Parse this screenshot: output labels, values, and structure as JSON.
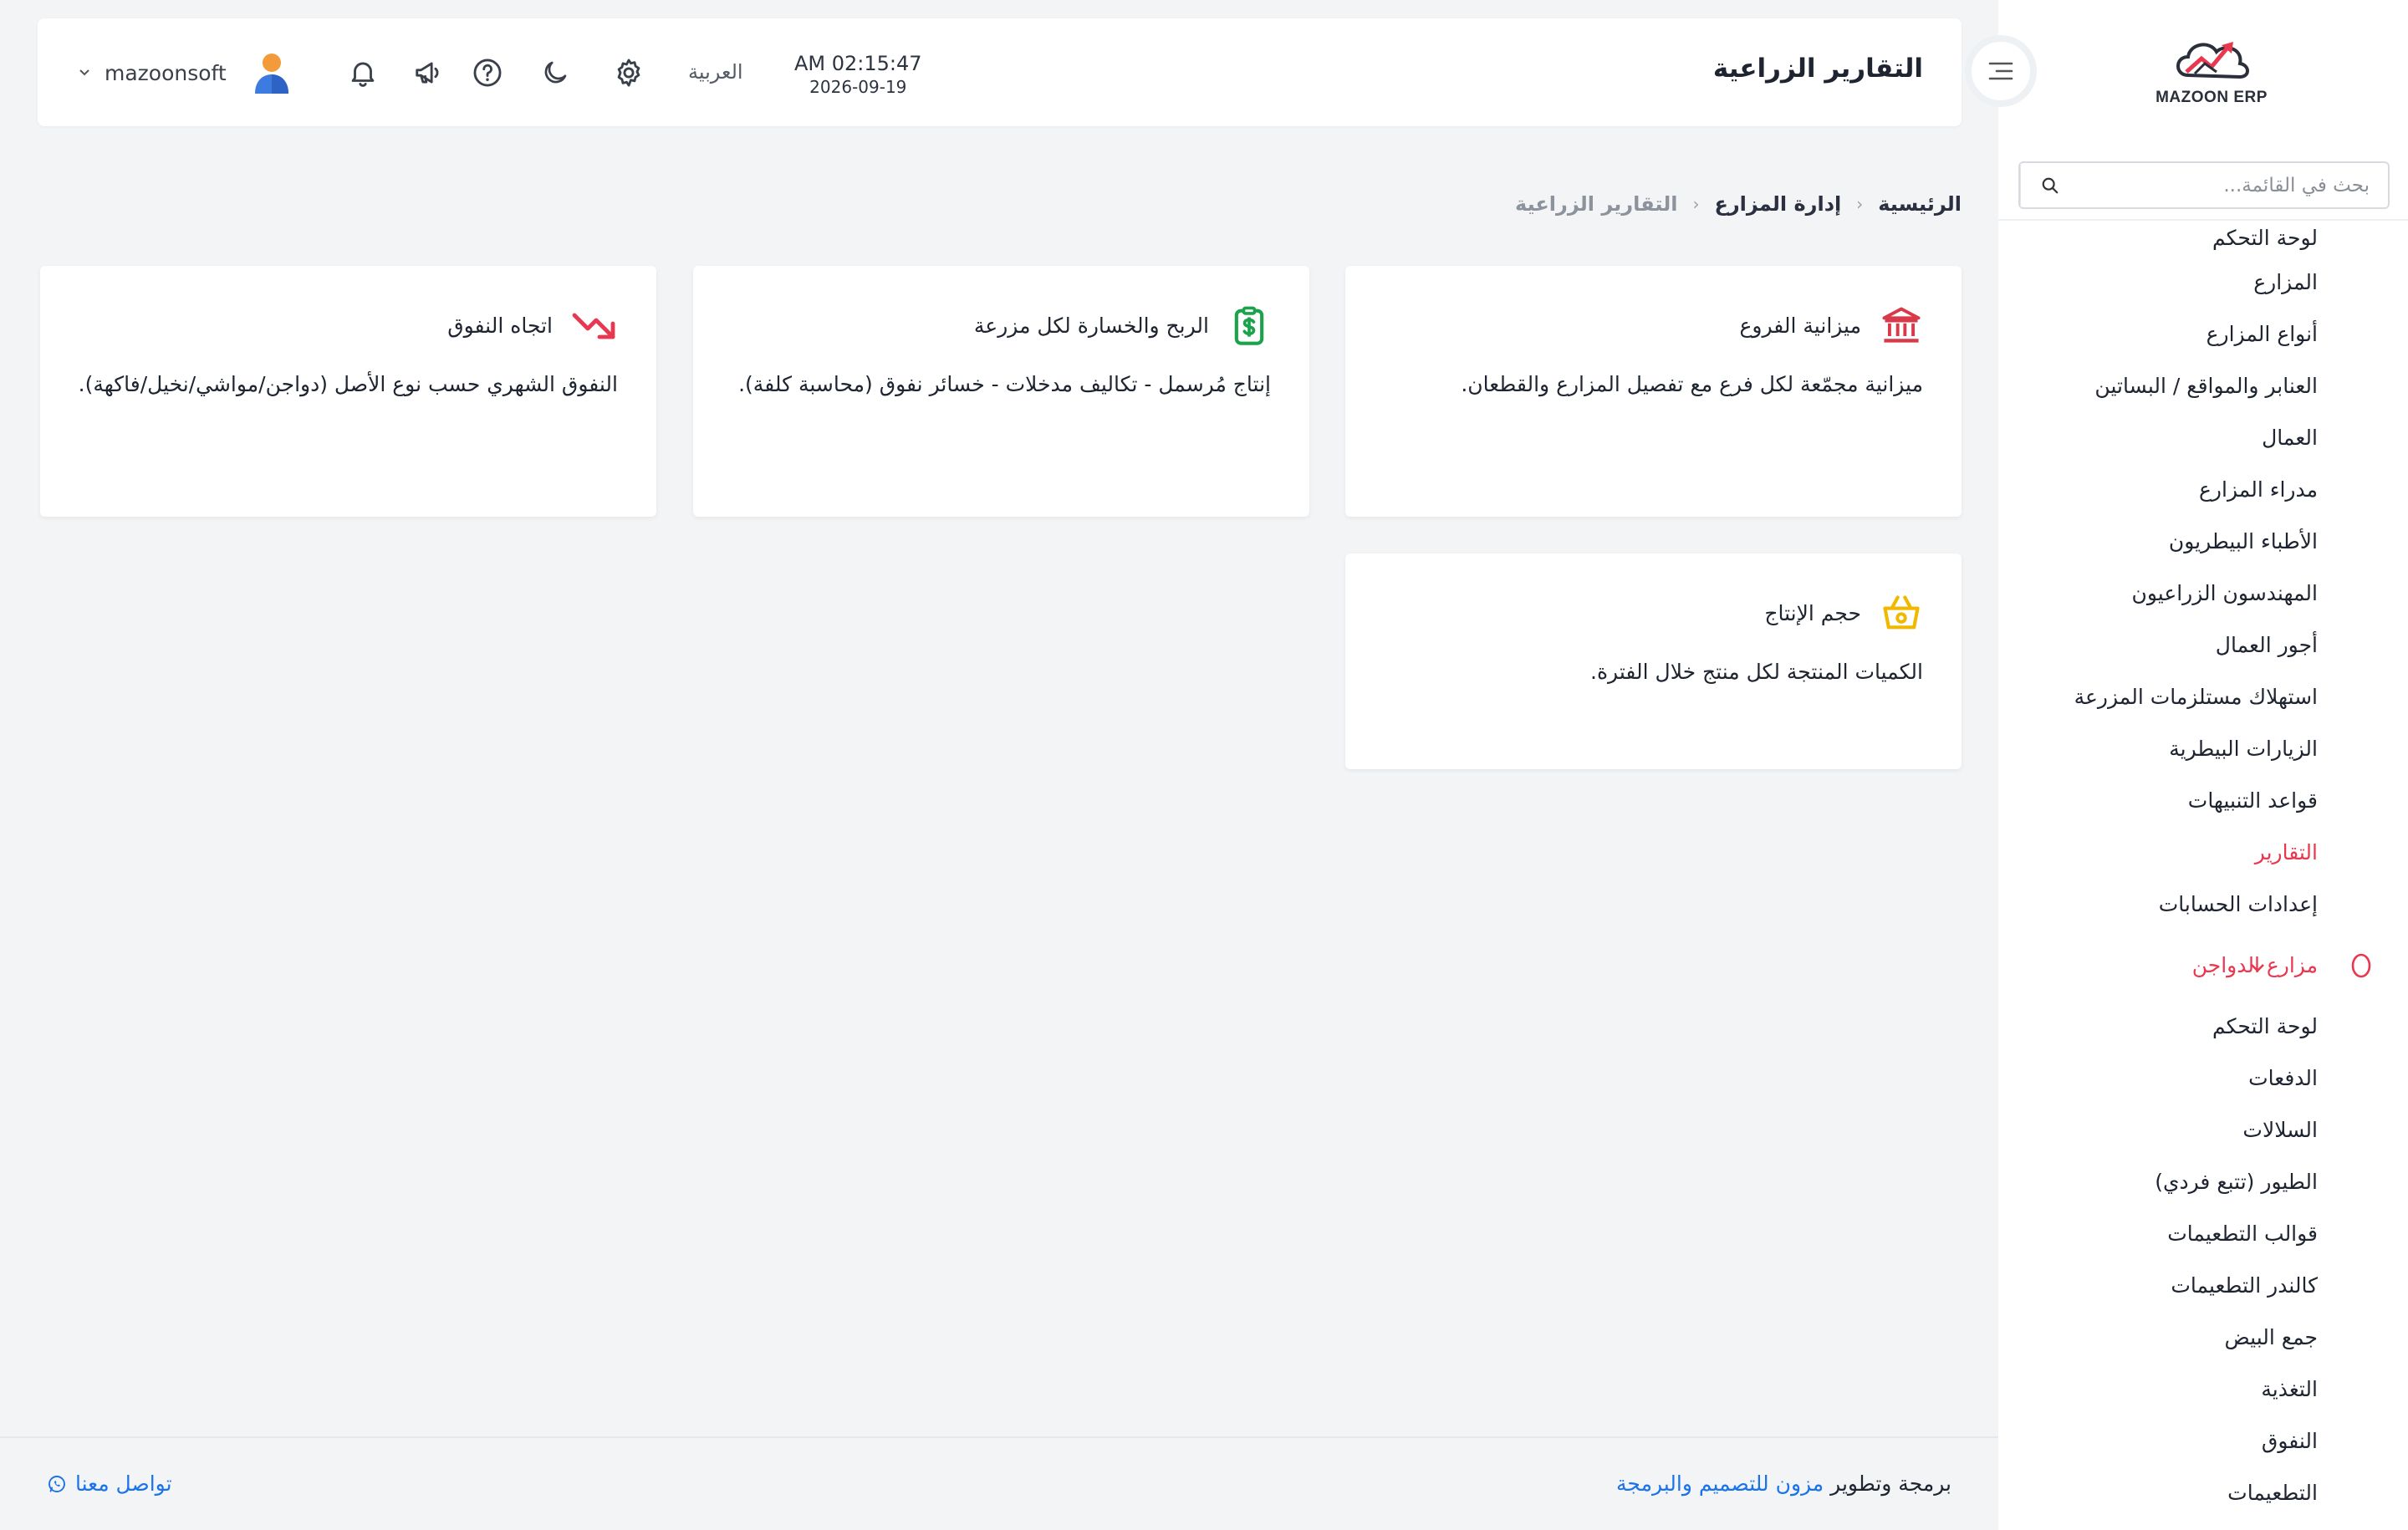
{
  "app": {
    "logo_text": "MAZOON ERP",
    "logo_sub": "ERP"
  },
  "header": {
    "page_title": "التقارير الزراعية",
    "time": "AM 02:15:47",
    "date": "2026-09-19",
    "language": "العربية",
    "username": "mazoonsoft"
  },
  "search": {
    "placeholder": "بحث في القائمة..."
  },
  "sidebar": {
    "items": [
      {
        "label": "لوحة التحكم"
      },
      {
        "label": "المزارع"
      },
      {
        "label": "أنواع المزارع"
      },
      {
        "label": "العنابر والمواقع / البساتين"
      },
      {
        "label": "العمال"
      },
      {
        "label": "مدراء المزارع"
      },
      {
        "label": "الأطباء البيطريون"
      },
      {
        "label": "المهندسون الزراعيون"
      },
      {
        "label": "أجور العمال"
      },
      {
        "label": "استهلاك مستلزمات المزرعة"
      },
      {
        "label": "الزيارات البيطرية"
      },
      {
        "label": "قواعد التنبيهات"
      },
      {
        "label": "التقارير"
      },
      {
        "label": "إعدادات الحسابات"
      }
    ],
    "group": {
      "label": "مزارع الدواجن",
      "items": [
        {
          "label": "لوحة التحكم"
        },
        {
          "label": "الدفعات"
        },
        {
          "label": "السلالات"
        },
        {
          "label": "الطيور (تتبع فردي)"
        },
        {
          "label": "قوالب التطعيمات"
        },
        {
          "label": "كالندر التطعيمات"
        },
        {
          "label": "جمع البيض"
        },
        {
          "label": "التغذية"
        },
        {
          "label": "النفوق"
        },
        {
          "label": "التطعيمات"
        }
      ]
    }
  },
  "breadcrumb": {
    "home": "الرئيسية",
    "section": "إدارة المزارع",
    "current": "التقارير الزراعية"
  },
  "cards": [
    {
      "title": "ميزانية الفروع",
      "desc": "ميزانية مجمّعة لكل فرع مع تفصيل المزارع والقطعان.",
      "icon": "bank-icon",
      "color": "#d93a4a"
    },
    {
      "title": "الربح والخسارة لكل مزرعة",
      "desc": "إنتاج مُرسمل - تكاليف مدخلات - خسائر نفوق (محاسبة كلفة).",
      "icon": "dollar-clipboard-icon",
      "color": "#1aa34a"
    },
    {
      "title": "اتجاه النفوق",
      "desc": "النفوق الشهري حسب نوع الأصل (دواجن/مواشي/نخيل/فاكهة).",
      "icon": "trend-down-icon",
      "color": "#e8384f"
    },
    {
      "title": "حجم الإنتاج",
      "desc": "الكميات المنتجة لكل منتج خلال الفترة.",
      "icon": "basket-icon",
      "color": "#f0b800"
    }
  ],
  "footer": {
    "credit_prefix": "برمجة وتطوير",
    "credit_brand": "مزون للتصميم والبرمجة",
    "contact": "تواصل معنا"
  },
  "colors": {
    "accent": "#e8384f",
    "link": "#1a73e8",
    "background": "#f2f4f6"
  }
}
